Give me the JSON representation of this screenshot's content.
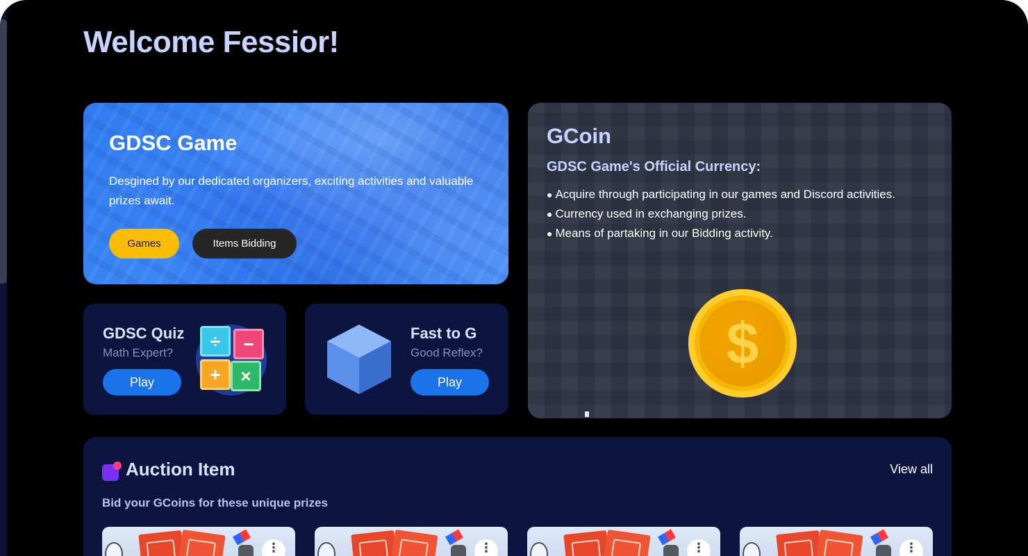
{
  "page": {
    "welcome": "Welcome Fessior!"
  },
  "hero": {
    "title": "GDSC Game",
    "description": "Desgined by our dedicated organizers, exciting activities and valuable prizes await.",
    "games_label": "Games",
    "bidding_label": "Items Bidding"
  },
  "gcoin": {
    "title": "GCoin",
    "subtitle": "GDSC Game's Official Currency:",
    "points": [
      "Acquire through participating in our games and Discord activities.",
      "Currency used in exchanging prizes.",
      "Means of partaking in our Bidding activity."
    ],
    "coin_symbol": "$"
  },
  "games": [
    {
      "title": "GDSC Quiz",
      "subtitle": "Math Expert?",
      "play_label": "Play",
      "icon": "math-operators-icon"
    },
    {
      "title": "Fast to G",
      "subtitle": "Good Reflex?",
      "play_label": "Play",
      "icon": "cube-icon"
    }
  ],
  "quiz_tiles": [
    "÷",
    "−",
    "+",
    "×"
  ],
  "auction": {
    "title": "Auction Item",
    "view_all": "View all",
    "subtitle": "Bid your GCoins for these unique prizes",
    "more_label": "⋮"
  },
  "colors": {
    "accent_blue": "#1a73e8",
    "accent_yellow": "#fbbc04",
    "card_navy": "#0b1540",
    "title_lavender": "#c7d4ff"
  }
}
